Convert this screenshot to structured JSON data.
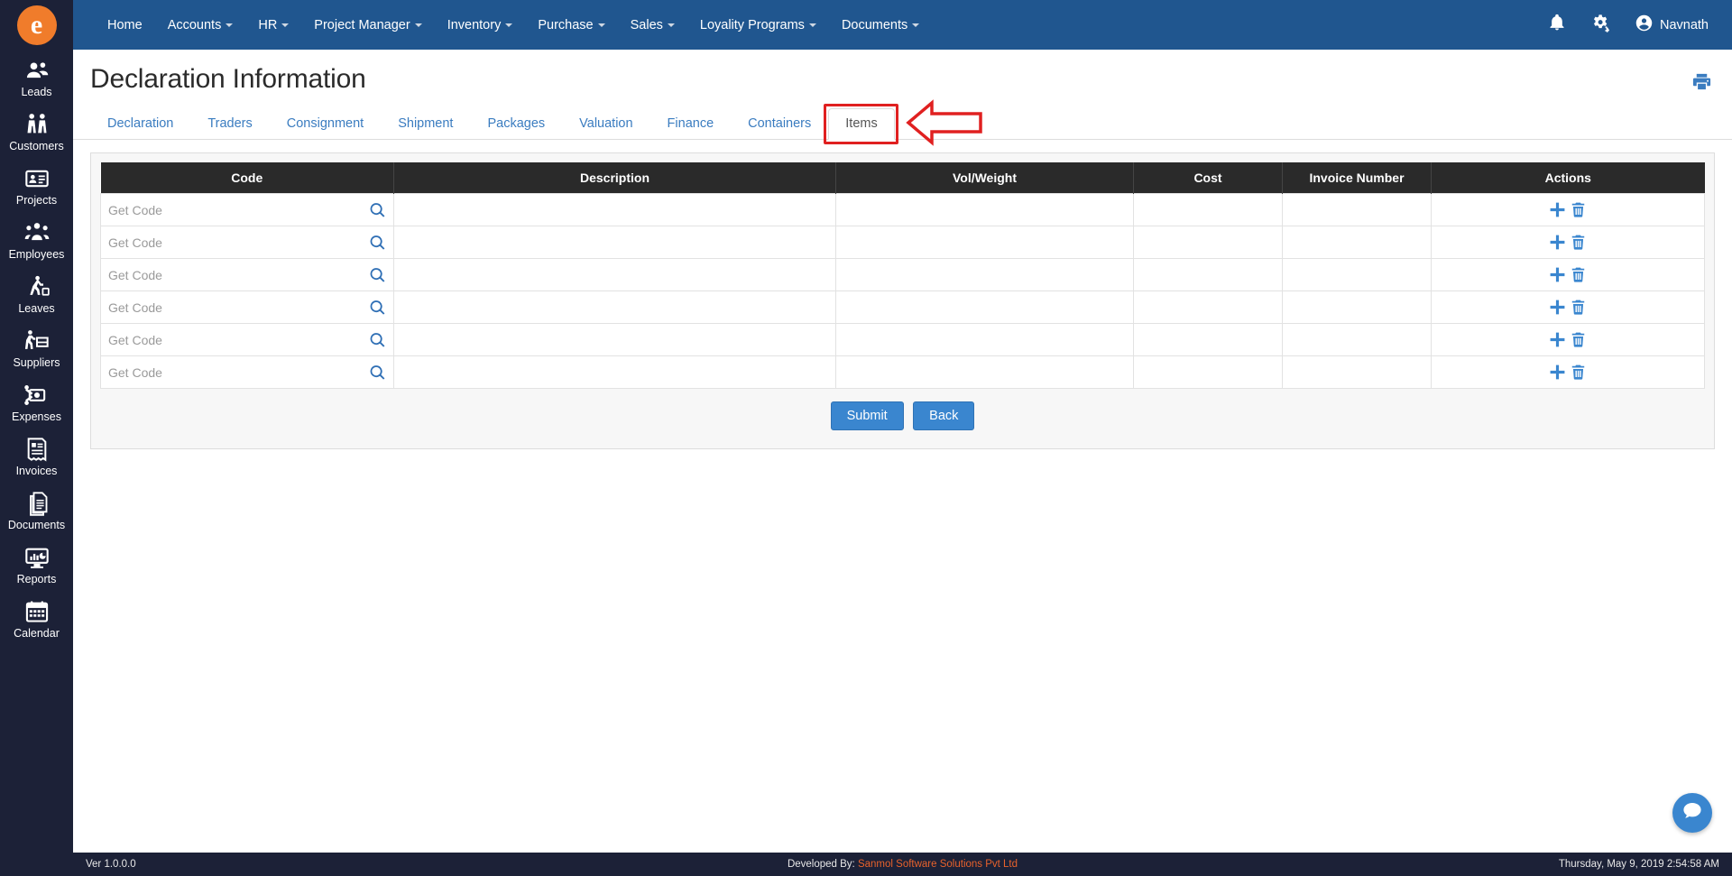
{
  "brand": {
    "logo_letter": "e"
  },
  "sidebar": {
    "items": [
      {
        "label": "Leads",
        "icon": "leads-icon"
      },
      {
        "label": "Customers",
        "icon": "customers-icon"
      },
      {
        "label": "Projects",
        "icon": "projects-icon"
      },
      {
        "label": "Employees",
        "icon": "employees-icon"
      },
      {
        "label": "Leaves",
        "icon": "leaves-icon"
      },
      {
        "label": "Suppliers",
        "icon": "suppliers-icon"
      },
      {
        "label": "Expenses",
        "icon": "expenses-icon"
      },
      {
        "label": "Invoices",
        "icon": "invoices-icon"
      },
      {
        "label": "Documents",
        "icon": "documents-icon"
      },
      {
        "label": "Reports",
        "icon": "reports-icon"
      },
      {
        "label": "Calendar",
        "icon": "calendar-icon"
      }
    ]
  },
  "topnav": {
    "items": [
      {
        "label": "Home",
        "has_caret": false
      },
      {
        "label": "Accounts",
        "has_caret": true
      },
      {
        "label": "HR",
        "has_caret": true
      },
      {
        "label": "Project Manager",
        "has_caret": true
      },
      {
        "label": "Inventory",
        "has_caret": true
      },
      {
        "label": "Purchase",
        "has_caret": true
      },
      {
        "label": "Sales",
        "has_caret": true
      },
      {
        "label": "Loyality Programs",
        "has_caret": true
      },
      {
        "label": "Documents",
        "has_caret": true
      }
    ],
    "user_name": "Navnath",
    "bell_icon": "bell-icon",
    "settings_icon": "gears-icon",
    "avatar_icon": "user-circle-icon"
  },
  "page": {
    "title": "Declaration Information",
    "print_icon": "printer-icon"
  },
  "tabs": [
    {
      "label": "Declaration",
      "active": false
    },
    {
      "label": "Traders",
      "active": false
    },
    {
      "label": "Consignment",
      "active": false
    },
    {
      "label": "Shipment",
      "active": false
    },
    {
      "label": "Packages",
      "active": false
    },
    {
      "label": "Valuation",
      "active": false
    },
    {
      "label": "Finance",
      "active": false
    },
    {
      "label": "Containers",
      "active": false
    },
    {
      "label": "Items",
      "active": true
    }
  ],
  "annotation": {
    "highlight_color": "#e02020",
    "target_tab": "Items",
    "shape": "left-pointing-arrow"
  },
  "table": {
    "columns": [
      "Code",
      "Description",
      "Vol/Weight",
      "Cost",
      "Invoice Number",
      "Actions"
    ],
    "code_placeholder": "Get Code",
    "search_icon": "search-icon",
    "add_icon": "plus-icon",
    "delete_icon": "trash-icon",
    "rows": [
      {
        "code": "",
        "description": "",
        "vol_weight": "",
        "cost": "",
        "invoice_number": ""
      },
      {
        "code": "",
        "description": "",
        "vol_weight": "",
        "cost": "",
        "invoice_number": ""
      },
      {
        "code": "",
        "description": "",
        "vol_weight": "",
        "cost": "",
        "invoice_number": ""
      },
      {
        "code": "",
        "description": "",
        "vol_weight": "",
        "cost": "",
        "invoice_number": ""
      },
      {
        "code": "",
        "description": "",
        "vol_weight": "",
        "cost": "",
        "invoice_number": ""
      },
      {
        "code": "",
        "description": "",
        "vol_weight": "",
        "cost": "",
        "invoice_number": ""
      }
    ]
  },
  "buttons": {
    "submit": "Submit",
    "back": "Back"
  },
  "chat": {
    "icon": "chat-bubble-icon"
  },
  "footer": {
    "version": "Ver 1.0.0.0",
    "developed_by_label": "Developed By:",
    "developed_by_company": "Sanmol Software Solutions Pvt Ltd",
    "datetime": "Thursday, May 9, 2019 2:54:58 AM"
  },
  "colors": {
    "topnav": "#20568f",
    "sidebar": "#1c2137",
    "accent_blue": "#3a86cf",
    "brand_orange": "#f07c2b",
    "table_header": "#2a2a2a",
    "annotation_red": "#e02020"
  }
}
